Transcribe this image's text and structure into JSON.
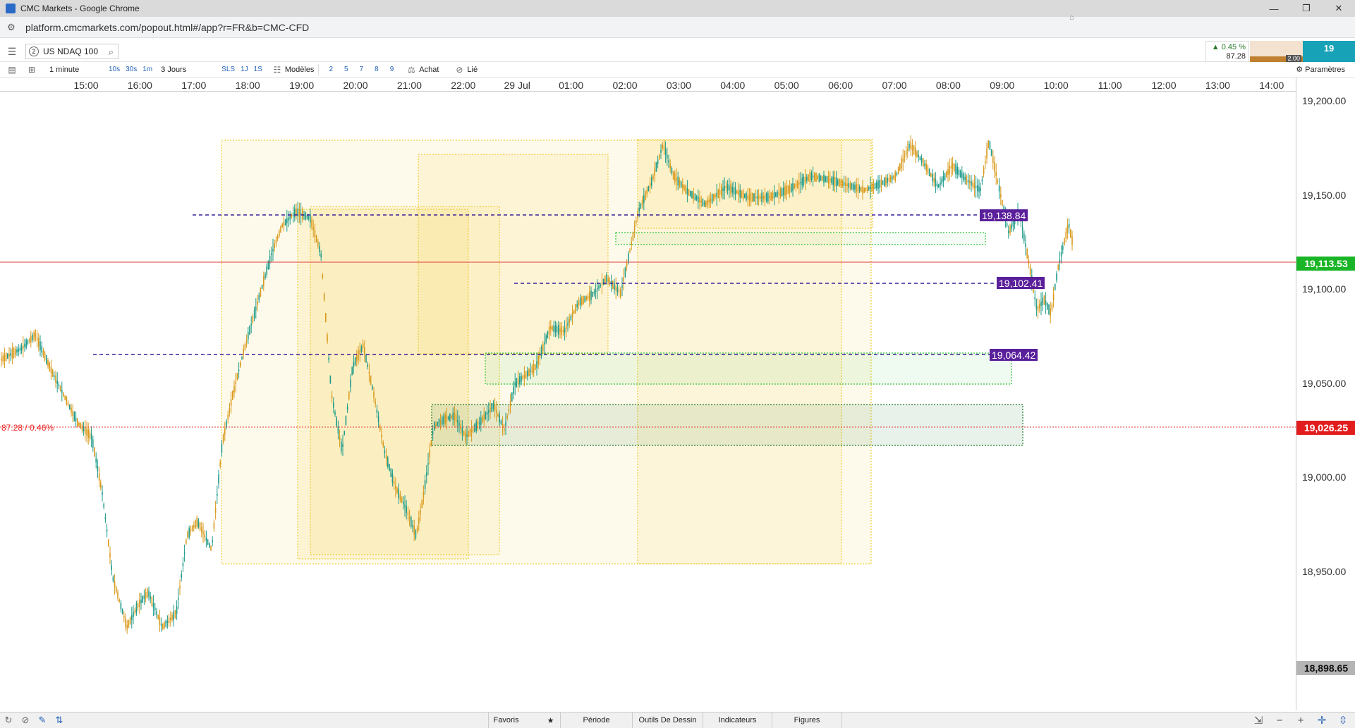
{
  "window": {
    "title": "CMC Markets - Google Chrome",
    "minimize": "—",
    "restore": "❐",
    "close": "✕"
  },
  "browser": {
    "url": "platform.cmcmarkets.com/popout.html#/app?r=FR&b=CMC-CFD"
  },
  "instrument": {
    "badge": "2",
    "name": "US NDAQ 100"
  },
  "quote": {
    "change_pct": "▲ 0.45 %",
    "change_abs": "87.28",
    "buy": "19",
    "spread": "2.00"
  },
  "toolbar": {
    "interval": "1 minute",
    "quick_intervals": [
      "10s",
      "30s",
      "1m"
    ],
    "range": "3 Jours",
    "quick_ranges": [
      "SLS",
      "1J",
      "1S"
    ],
    "templates_label": "Modèles",
    "layout_counts": [
      "2",
      "5",
      "7",
      "8",
      "9"
    ],
    "buy_label": "Achat",
    "linked_label": "Lié",
    "settings_label": "Paramètres"
  },
  "time_axis": [
    "15:00",
    "16:00",
    "17:00",
    "18:00",
    "19:00",
    "20:00",
    "21:00",
    "22:00",
    "29 Jul",
    "01:00",
    "02:00",
    "03:00",
    "04:00",
    "05:00",
    "06:00",
    "07:00",
    "08:00",
    "09:00",
    "10:00",
    "11:00",
    "12:00",
    "13:00",
    "14:00"
  ],
  "price_axis": [
    "19,200.00",
    "19,150.00",
    "19,100.00",
    "19,050.00",
    "19,000.00",
    "18,950.00"
  ],
  "price_tags": {
    "current": {
      "value": "19,113.53",
      "color": "#19b526"
    },
    "open_ref": {
      "value": "19,026.25",
      "color": "#e21d1d"
    },
    "low": {
      "value": "18,898.65",
      "color": "#b4b4b4"
    }
  },
  "levels": [
    {
      "value": "19,138.84"
    },
    {
      "value": "19,102.41"
    },
    {
      "value": "19,064.42"
    }
  ],
  "change_label": "87.28 / 0.46%",
  "bottom": {
    "tabs": [
      "Favoris",
      "Période",
      "Outils De Dessin",
      "Indicateurs",
      "Figures"
    ]
  },
  "colors": {
    "candle_up": "#1e9b8a",
    "candle_down": "#d99a1c",
    "level_line": "#3b1f9a",
    "current_line": "#e23b3b",
    "zone_yellow": "#f4d03f",
    "zone_green": "#34c23c"
  }
}
